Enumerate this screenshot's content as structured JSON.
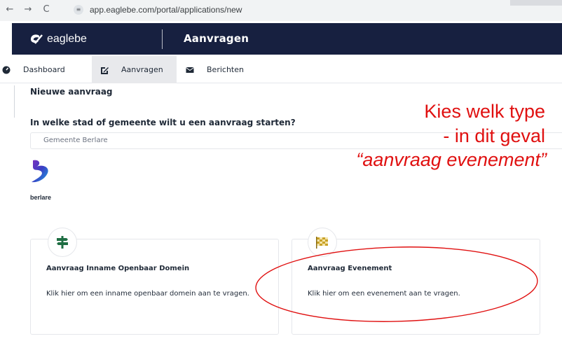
{
  "browser": {
    "back_icon": "←",
    "forward_icon": "→",
    "reload_icon": "C",
    "site_icon": "tune-icon",
    "url": "app.eaglebe.com/portal/applications/new"
  },
  "header": {
    "logo_text": "eaglebe",
    "title": "Aanvragen"
  },
  "subnav": {
    "items": [
      {
        "label": "Dashboard",
        "icon": "dashboard-icon"
      },
      {
        "label": "Aanvragen",
        "icon": "edit-icon"
      },
      {
        "label": "Berichten",
        "icon": "envelope-icon"
      }
    ]
  },
  "main": {
    "section_title": "Nieuwe aanvraag",
    "question": "In welke stad of gemeente wilt u een aanvraag starten?",
    "municipality_value": "Gemeente Berlare",
    "municipality_logo_name": "berlare"
  },
  "cards": [
    {
      "icon": "signpost-icon",
      "title": "Aanvraag Inname Openbaar Domein",
      "description": "Klik hier om een inname openbaar domein aan te vragen."
    },
    {
      "icon": "checkered-flag-icon",
      "title": "Aanvraag Evenement",
      "description": "Klik hier om een evenement aan te vragen."
    }
  ],
  "annotation": {
    "line_1": "Kies welk type",
    "line_2": "- in dit geval",
    "line_3": "“aanvraag evenement”",
    "color": "#e01010"
  },
  "colors": {
    "header_bg": "#172040",
    "active_tab_bg": "#e8e9ec",
    "signpost_green": "#1f6e43",
    "flag_gold": "#c9a227"
  }
}
